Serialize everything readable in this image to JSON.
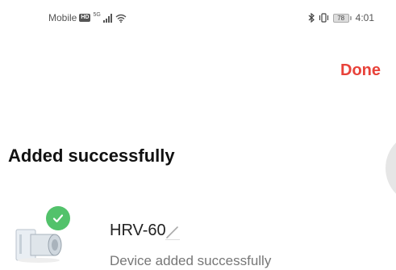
{
  "status_bar": {
    "carrier": "Mobile",
    "hd_badge": "HD",
    "signal_super": "5G",
    "battery_level": "78",
    "time": "4:01",
    "icons": [
      "signal-icon",
      "wifi-icon",
      "bluetooth-icon",
      "vibrate-icon",
      "battery-icon"
    ]
  },
  "header": {
    "done_label": "Done"
  },
  "main": {
    "title": "Added successfully"
  },
  "device": {
    "name": "HRV-60",
    "status": "Device added successfully",
    "icons": [
      "device-image",
      "check-icon",
      "edit-pencil-icon"
    ]
  },
  "colors": {
    "accent": "#e8423a",
    "success": "#52c26b",
    "secondary_text": "#777777"
  }
}
